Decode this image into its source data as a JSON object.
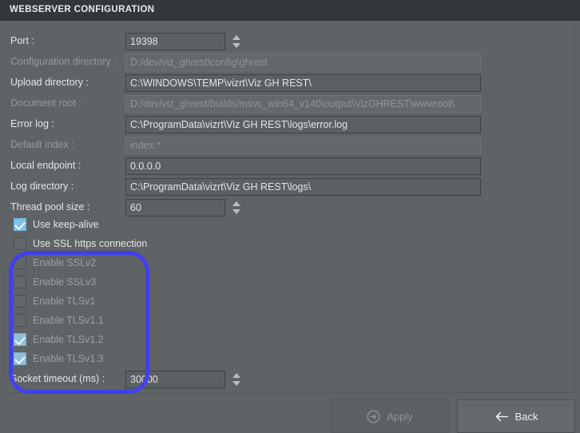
{
  "window": {
    "title": "WEBSERVER CONFIGURATION"
  },
  "colors": {
    "panel_bg": "#5f6366",
    "titlebar_bg": "#32373b",
    "field_bg": "#5b6064",
    "readonly_field_bg": "#63686b",
    "annotation_blue": "#4040ef",
    "checkbox_checked": "#8fc0d8",
    "keep_alive_checked": "#7ec2ee"
  },
  "form": {
    "fields": [
      {
        "label": "Port :",
        "value": "19398",
        "placeholder": "",
        "readonly": false,
        "size": "narrow",
        "spinner": true,
        "name": "port"
      },
      {
        "label": "Configuration directory :",
        "value": "D:/dev/viz_ghrest\\config\\ghrest",
        "placeholder": "",
        "readonly": true,
        "size": "wide",
        "spinner": false,
        "name": "configuration-directory"
      },
      {
        "label": "Upload directory :",
        "value": "C:\\WINDOWS\\TEMP\\vizrt\\Viz GH REST\\",
        "placeholder": "",
        "readonly": false,
        "size": "wide",
        "spinner": false,
        "name": "upload-directory"
      },
      {
        "label": "Document root :",
        "value": "D:/dev/viz_ghrest/builds/msvc_win64_v140\\output\\VizGHREST\\wwwroot\\",
        "placeholder": "",
        "readonly": true,
        "size": "wide",
        "spinner": false,
        "name": "document-root"
      },
      {
        "label": "Error log :",
        "value": "C:\\ProgramData\\vizrt\\Viz GH REST\\logs\\error.log",
        "placeholder": "",
        "readonly": false,
        "size": "wide",
        "spinner": false,
        "name": "error-log"
      },
      {
        "label": "Default index :",
        "value": "index.*",
        "placeholder": "",
        "readonly": true,
        "size": "wide",
        "spinner": false,
        "name": "default-index"
      },
      {
        "label": "Local endpoint :",
        "value": "0.0.0.0",
        "placeholder": "",
        "readonly": false,
        "size": "wide",
        "spinner": false,
        "name": "local-endpoint"
      },
      {
        "label": "Log directory :",
        "value": "C:\\ProgramData\\vizrt\\Viz GH REST\\logs\\",
        "placeholder": "",
        "readonly": false,
        "size": "wide",
        "spinner": false,
        "name": "log-directory"
      },
      {
        "label": "Thread pool size :",
        "value": "60",
        "placeholder": "",
        "readonly": false,
        "size": "narrow",
        "spinner": true,
        "name": "thread-pool-size"
      }
    ],
    "checkboxes": [
      {
        "label": "Use keep-alive",
        "checked": true,
        "enabled": true,
        "name": "use-keep-alive"
      },
      {
        "label": "Use SSL https connection",
        "checked": false,
        "enabled": true,
        "name": "use-ssl-https-connection"
      },
      {
        "label": "Enable SSLv2",
        "checked": false,
        "enabled": false,
        "name": "enable-sslv2"
      },
      {
        "label": "Enable SSLv3",
        "checked": false,
        "enabled": false,
        "name": "enable-sslv3"
      },
      {
        "label": "Enable TLSv1",
        "checked": false,
        "enabled": false,
        "name": "enable-tlsv1"
      },
      {
        "label": "Enable TLSv1.1",
        "checked": false,
        "enabled": false,
        "name": "enable-tlsv1-1"
      },
      {
        "label": "Enable TLSv1.2",
        "checked": true,
        "enabled": false,
        "name": "enable-tlsv1-2"
      },
      {
        "label": "Enable TLSv1.3",
        "checked": true,
        "enabled": false,
        "name": "enable-tlsv1-3"
      }
    ],
    "socket_timeout": {
      "label": "Socket timeout (ms) :",
      "value": "30000",
      "name": "socket-timeout"
    }
  },
  "footer": {
    "apply_label": "Apply",
    "apply_icon": "circled-arrow-right-icon",
    "apply_disabled": true,
    "back_label": "Back",
    "back_icon": "arrow-left-icon"
  }
}
